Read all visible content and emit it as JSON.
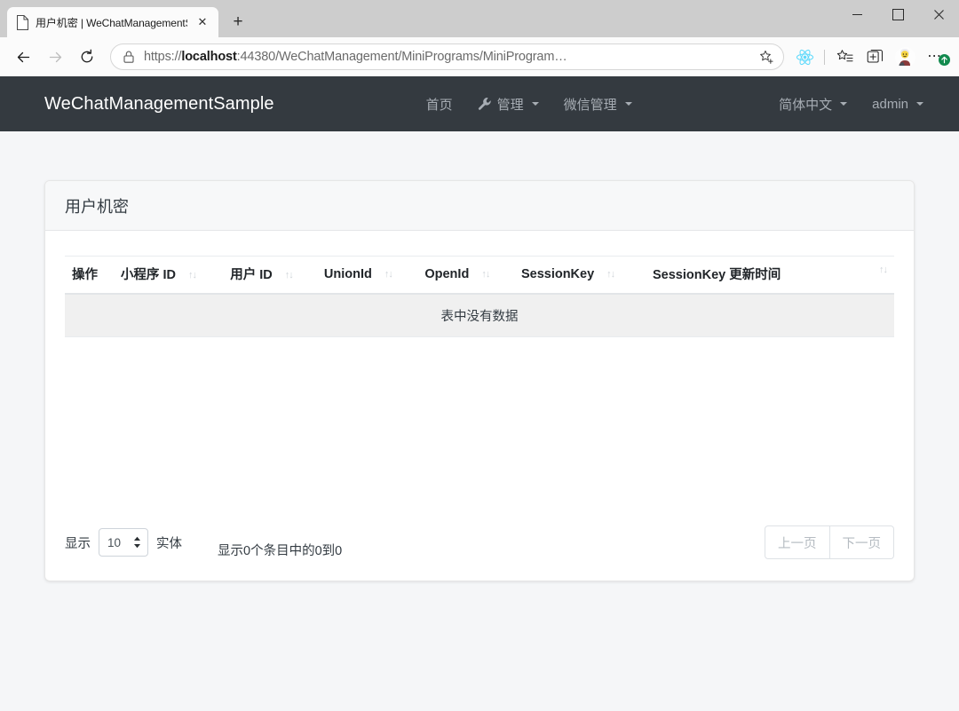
{
  "browser": {
    "tab": {
      "title": "用户机密 | WeChatManagementS",
      "close_label": "✕",
      "favicon": "page-icon"
    },
    "newtab_label": "+",
    "window": {
      "minimize": "–",
      "maximize": "□",
      "close": "✕"
    },
    "nav": {
      "back": "←",
      "forward": "→",
      "reload": "↻"
    },
    "url": {
      "scheme": "https://",
      "host": "localhost",
      "rest": ":44380/WeChatManagement/MiniPrograms/MiniProgram…"
    },
    "url_full": "https://localhost:44380/WeChatManagement/MiniPrograms/MiniProgram…",
    "toolbar_icons": [
      {
        "name": "favorites-star-icon",
        "glyph": "☆"
      },
      {
        "name": "react-devtools-icon",
        "glyph": "⚛",
        "color": "#61dafb"
      },
      {
        "name": "collections-icon",
        "glyph": "✩"
      },
      {
        "name": "browser-essentials-icon",
        "glyph": "⊞"
      },
      {
        "name": "profile-avatar-icon",
        "glyph": "👩‍💻"
      },
      {
        "name": "settings-more-icon",
        "glyph": "⋯",
        "badge": "↑"
      }
    ]
  },
  "app": {
    "brand": "WeChatManagementSample",
    "nav_main": [
      {
        "label": "首页",
        "icon": null,
        "dropdown": false
      },
      {
        "label": "管理",
        "icon": "wrench-icon",
        "dropdown": true
      },
      {
        "label": "微信管理",
        "icon": null,
        "dropdown": true
      }
    ],
    "nav_right": [
      {
        "label": "简体中文",
        "dropdown": true
      },
      {
        "label": "admin",
        "dropdown": true
      }
    ]
  },
  "card": {
    "title": "用户机密"
  },
  "table": {
    "columns": [
      {
        "label": "操作",
        "sortable": false
      },
      {
        "label": "小程序 ID",
        "sortable": true
      },
      {
        "label": "用户 ID",
        "sortable": true
      },
      {
        "label": "UnionId",
        "sortable": true
      },
      {
        "label": "OpenId",
        "sortable": true
      },
      {
        "label": "SessionKey",
        "sortable": true
      },
      {
        "label": "SessionKey 更新时间",
        "sortable": true
      }
    ],
    "sort_glyph": "↑↓",
    "rows": [],
    "empty_message": "表中没有数据"
  },
  "footer": {
    "length_prefix": "显示",
    "page_size": "10",
    "length_suffix": "实体",
    "info": "显示0个条目中的0到0",
    "prev_label": "上一页",
    "next_label": "下一页"
  },
  "colors": {
    "navbar": "#343a40",
    "page_bg": "#f5f6f8",
    "card_bg": "#ffffff",
    "card_header_bg": "#f7f8f9",
    "empty_row_bg": "#f0f0f0",
    "nav_link": "#a7adb4",
    "badge_green": "#128a4e"
  }
}
